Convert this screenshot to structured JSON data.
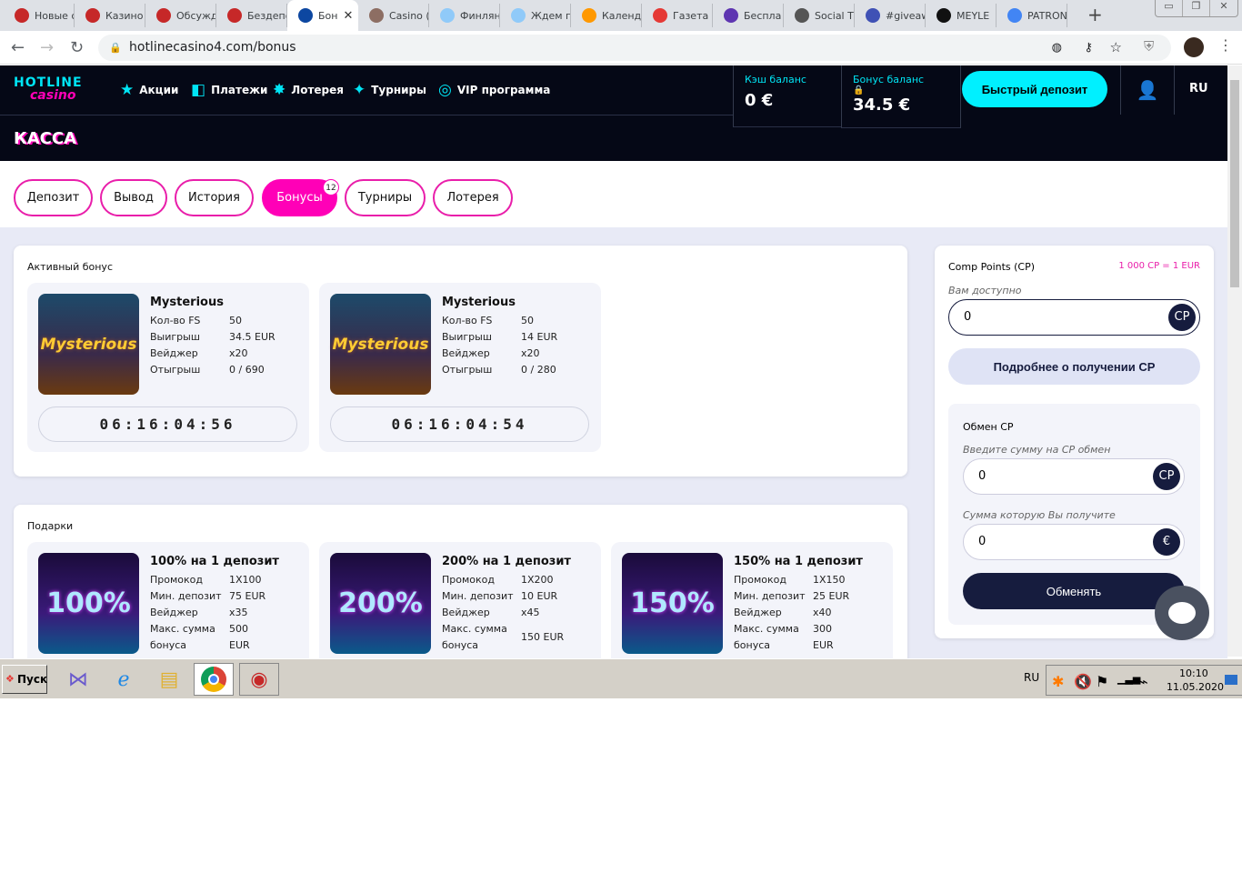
{
  "browser": {
    "tabs": [
      {
        "label": "Новые с",
        "color": "#c62828"
      },
      {
        "label": "Казино",
        "color": "#c62828"
      },
      {
        "label": "Обсужд",
        "color": "#c62828"
      },
      {
        "label": "Бездепо",
        "color": "#c62828"
      },
      {
        "label": "Бон",
        "color": "#0d47a1",
        "active": true
      },
      {
        "label": "Casino (",
        "color": "#8d6e63"
      },
      {
        "label": "Финлян",
        "color": "#90caf9"
      },
      {
        "label": "Ждем п",
        "color": "#90caf9"
      },
      {
        "label": "Календ",
        "color": "#ff9800"
      },
      {
        "label": "Газета",
        "color": "#e53935"
      },
      {
        "label": "Беспла",
        "color": "#5e35b1"
      },
      {
        "label": "Social T",
        "color": "#555"
      },
      {
        "label": "#giveaw",
        "color": "#3f51b5"
      },
      {
        "label": "MEYLE",
        "color": "#111"
      },
      {
        "label": "PATRON",
        "color": "#4285f4"
      }
    ],
    "url": "hotlinecasino4.com/bonus"
  },
  "site": {
    "logo_top": "HOTLINE",
    "logo_bottom": "casino",
    "nav": [
      {
        "label": "Акции",
        "icon": "★"
      },
      {
        "label": "Платежи",
        "icon": "◧"
      },
      {
        "label": "Лотерея",
        "icon": "✸"
      },
      {
        "label": "Турниры",
        "icon": "✦"
      },
      {
        "label": "VIP программа",
        "icon": "◎"
      }
    ],
    "cash_label": "Кэш баланс",
    "cash_value": "0 €",
    "bonus_label": "Бонус баланс",
    "bonus_value": "34.5 €",
    "quick_deposit": "Быстрый депозит",
    "lang": "RU",
    "page_title": "КАССА"
  },
  "cashier_tabs": [
    {
      "label": "Депозит"
    },
    {
      "label": "Вывод"
    },
    {
      "label": "История"
    },
    {
      "label": "Бонусы",
      "active": true,
      "badge": "12"
    },
    {
      "label": "Турниры"
    },
    {
      "label": "Лотерея"
    }
  ],
  "active_bonus": {
    "title": "Активный бонус",
    "items": [
      {
        "name": "Mysterious",
        "image_text": "Mysterious",
        "rows": [
          [
            "Кол-во FS",
            "50"
          ],
          [
            "Выигрыш",
            "34.5 EUR"
          ],
          [
            "Вейджер",
            "x20"
          ],
          [
            "Отыгрыш",
            "0 / 690"
          ]
        ],
        "timer": "06:16:04:56"
      },
      {
        "name": "Mysterious",
        "image_text": "Mysterious",
        "rows": [
          [
            "Кол-во FS",
            "50"
          ],
          [
            "Выигрыш",
            "14 EUR"
          ],
          [
            "Вейджер",
            "x20"
          ],
          [
            "Отыгрыш",
            "0 / 280"
          ]
        ],
        "timer": "06:16:04:54"
      }
    ]
  },
  "gifts": {
    "title": "Подарки",
    "items": [
      {
        "name": "100% на 1 депозит",
        "image_text": "100%",
        "rows": [
          [
            "Промокод",
            "1X100"
          ],
          [
            "Мин. депозит",
            "75 EUR"
          ],
          [
            "Вейджер",
            "x35"
          ],
          [
            "Макс. сумма",
            "500"
          ],
          [
            "бонуса",
            "EUR"
          ]
        ]
      },
      {
        "name": "200% на 1 депозит",
        "image_text": "200%",
        "rows": [
          [
            "Промокод",
            "1X200"
          ],
          [
            "Мин. депозит",
            "10 EUR"
          ],
          [
            "Вейджер",
            "x45"
          ],
          [
            "Макс. сумма",
            ""
          ],
          [
            "бонуса",
            "150 EUR"
          ]
        ]
      },
      {
        "name": "150% на 1 депозит",
        "image_text": "150%",
        "rows": [
          [
            "Промокод",
            "1X150"
          ],
          [
            "Мин. депозит",
            "25 EUR"
          ],
          [
            "Вейджер",
            "x40"
          ],
          [
            "Макс. сумма",
            "300"
          ],
          [
            "бонуса",
            "EUR"
          ]
        ]
      }
    ]
  },
  "comp": {
    "title": "Comp Points (CP)",
    "rate": "1 000 CP = 1 EUR",
    "available_label": "Вам доступно",
    "available_value": "0",
    "cp": "CP",
    "more_button": "Подробнее о получении CP",
    "exchange_title": "Обмен CP",
    "enter_label": "Введите сумму на CP обмен",
    "enter_value": "0",
    "receive_label": "Сумма которую Вы получите",
    "receive_value": "0",
    "euro": "€",
    "exchange_button": "Обменять"
  },
  "taskbar": {
    "start": "Пуск",
    "lang": "RU",
    "time": "10:10",
    "date": "11.05.2020"
  }
}
